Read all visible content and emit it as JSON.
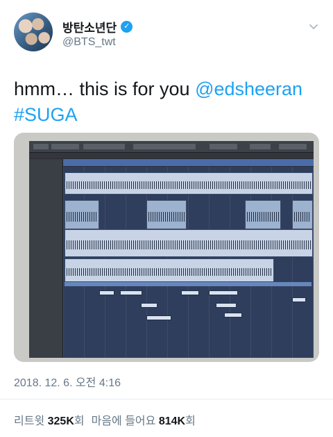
{
  "author": {
    "display_name": "방탄소년단",
    "handle": "@BTS_twt",
    "verified": true,
    "verified_icon": "check-icon"
  },
  "tweet": {
    "text_prefix": "hmm… this is for you ",
    "mention": "@edsheeran",
    "hashtag": "#SUGA",
    "link_color": "#1da1f2"
  },
  "media": {
    "type": "photo of DAW project screen (Cubase)"
  },
  "timestamp": "2018. 12. 6. 오전 4:16",
  "stats": {
    "retweets_label": "리트윗",
    "retweets_value": "325K",
    "retweets_unit": "회",
    "likes_label": "마음에 들어요",
    "likes_value": "814K",
    "likes_unit": "회"
  },
  "colors": {
    "text": "#14171a",
    "secondary": "#657786",
    "accent": "#1da1f2"
  }
}
